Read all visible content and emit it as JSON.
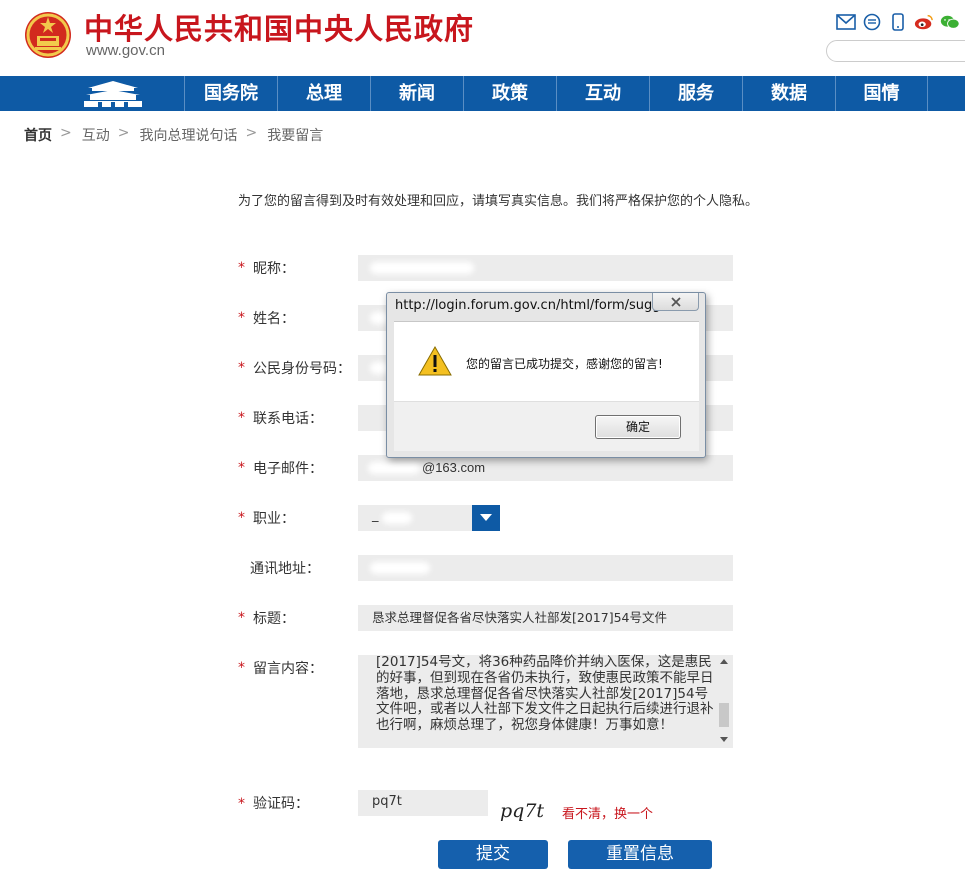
{
  "header": {
    "site_title": "中华人民共和国中央人民政府",
    "site_url": "www.gov.cn",
    "icons": [
      "mail-icon",
      "message-icon",
      "phone-icon",
      "weibo-icon",
      "wechat-icon"
    ],
    "brand_color": "#c8161d"
  },
  "nav": {
    "color": "#0e5aa5",
    "items": [
      "国务院",
      "总理",
      "新闻",
      "政策",
      "互动",
      "服务",
      "数据",
      "国情"
    ]
  },
  "breadcrumb": {
    "items": [
      "首页",
      "互动",
      "我向总理说句话",
      "我要留言"
    ],
    "separator": ">"
  },
  "intro": "为了您的留言得到及时有效处理和回应，请填写真实信息。我们将严格保护您的个人隐私。",
  "form": {
    "nickname_label": "昵称：",
    "name_label": "姓名：",
    "id_label": "公民身份号码：",
    "phone_label": "联系电话：",
    "email_label": "电子邮件：",
    "email_value": "@163.com",
    "job_label": "职业：",
    "job_value": "_",
    "address_label": "通讯地址：",
    "subject_label": "标题：",
    "subject_value": "恳求总理督促各省尽快落实人社部发[2017]54号文件",
    "content_label": "留言内容：",
    "content_value": "[2017]54号文，将36种药品降价并纳入医保，这是惠民的好事，但到现在各省仍未执行，致使惠民政策不能早日落地，恳求总理督促各省尽快落实人社部发[2017]54号文件吧，或者以人社部下发文件之日起执行后续进行退补也行啊，麻烦总理了，祝您身体健康！万事如意！",
    "captcha_label": "验证码：",
    "captcha_value": "pq7t",
    "captcha_image_text": "pq7t",
    "captcha_refresh": "看不清，换一个",
    "submit_label": "提交",
    "reset_label": "重置信息",
    "required_mark": "*"
  },
  "dialog": {
    "title": "http://login.forum.gov.cn/html/form/sugg...",
    "message": "您的留言已成功提交，感谢您的留言!",
    "ok_label": "确定",
    "icon": "warning-icon"
  }
}
